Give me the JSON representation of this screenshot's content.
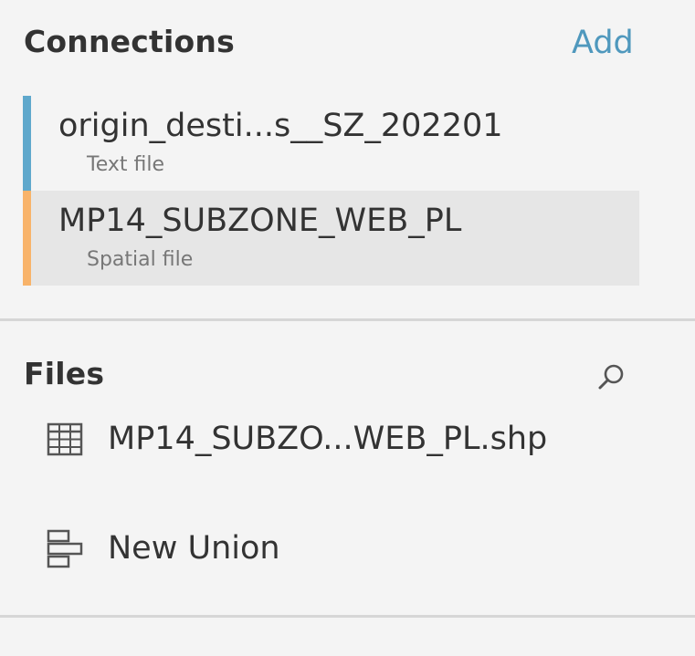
{
  "connections": {
    "title": "Connections",
    "add_label": "Add",
    "items": [
      {
        "name": "origin_desti...s__SZ_202201",
        "type": "Text file",
        "color": "#5fa8cc",
        "selected": false
      },
      {
        "name": "MP14_SUBZONE_WEB_PL",
        "type": "Spatial file",
        "color": "#f8b36a",
        "selected": true
      }
    ]
  },
  "files": {
    "title": "Files",
    "search_icon": "search-icon",
    "items": [
      {
        "label": "MP14_SUBZO...WEB_PL.shp",
        "icon": "table-grid-icon"
      }
    ],
    "new_union": {
      "label": "New Union",
      "icon": "union-icon"
    }
  },
  "colors": {
    "background": "#f4f4f4",
    "selected_row": "#e6e6e6",
    "accent_link": "#4f98bd",
    "divider": "#d6d6d6"
  }
}
